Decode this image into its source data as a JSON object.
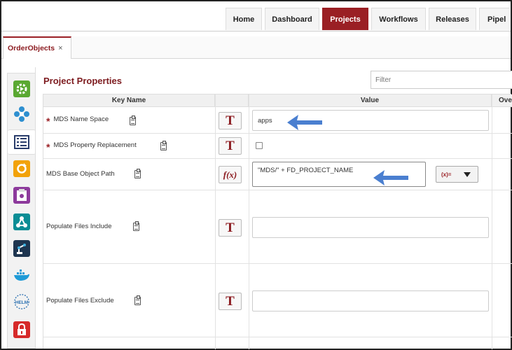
{
  "nav": {
    "items": [
      {
        "label": "Home",
        "active": false
      },
      {
        "label": "Dashboard",
        "active": false
      },
      {
        "label": "Projects",
        "active": true
      },
      {
        "label": "Workflows",
        "active": false
      },
      {
        "label": "Releases",
        "active": false
      },
      {
        "label": "Pipel",
        "active": false
      }
    ]
  },
  "tab": {
    "label": "OrderObjects",
    "close": "×"
  },
  "rail": {
    "icons": [
      "gear-icon",
      "integration-icon",
      "properties-list-icon",
      "refresh-icon",
      "report-icon",
      "network-icon",
      "robot-arm-icon",
      "docker-icon",
      "helm-icon",
      "lock-icon"
    ],
    "helm_text": "HELM"
  },
  "panel": {
    "title": "Project Properties",
    "filter_placeholder": "Filter"
  },
  "grid": {
    "headers": {
      "key": "Key Name",
      "value": "Value",
      "override": "Ove"
    },
    "rows": [
      {
        "key": "MDS Name Space",
        "required": true,
        "type_button": "T",
        "value": "apps",
        "kind": "text"
      },
      {
        "key": "MDS Property Replacement",
        "required": true,
        "type_button": "T",
        "value": "",
        "kind": "checkbox"
      },
      {
        "key": "MDS Base Object Path",
        "required": false,
        "type_button": "f(x)",
        "value": "\"MDS/\" + FD_PROJECT_NAME",
        "kind": "expression",
        "var_dropdown": "(x)="
      },
      {
        "key": "Populate Files Include",
        "required": false,
        "type_button": "T",
        "value": "",
        "kind": "text"
      },
      {
        "key": "Populate Files Exclude",
        "required": false,
        "type_button": "T",
        "value": "",
        "kind": "text"
      }
    ],
    "required_mark": "*"
  },
  "colors": {
    "brand": "#9a1f24",
    "arrow": "#4a7fd0"
  }
}
